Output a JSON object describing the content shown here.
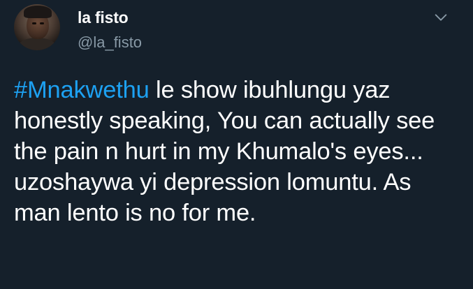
{
  "tweet": {
    "author": {
      "display_name": "la fisto",
      "handle": "@la_fisto"
    },
    "menu_icon": "chevron-down-icon",
    "hashtag": "#Mnakwethu",
    "text_rest": " le show ibuhlungu yaz honestly speaking, You can actually see the pain n hurt in my Khumalo's eyes... uzoshaywa yi depression lomuntu. As man lento is no for me."
  },
  "colors": {
    "background": "#15202b",
    "text": "#ffffff",
    "secondary_text": "#8899a6",
    "link": "#1da1f2"
  }
}
